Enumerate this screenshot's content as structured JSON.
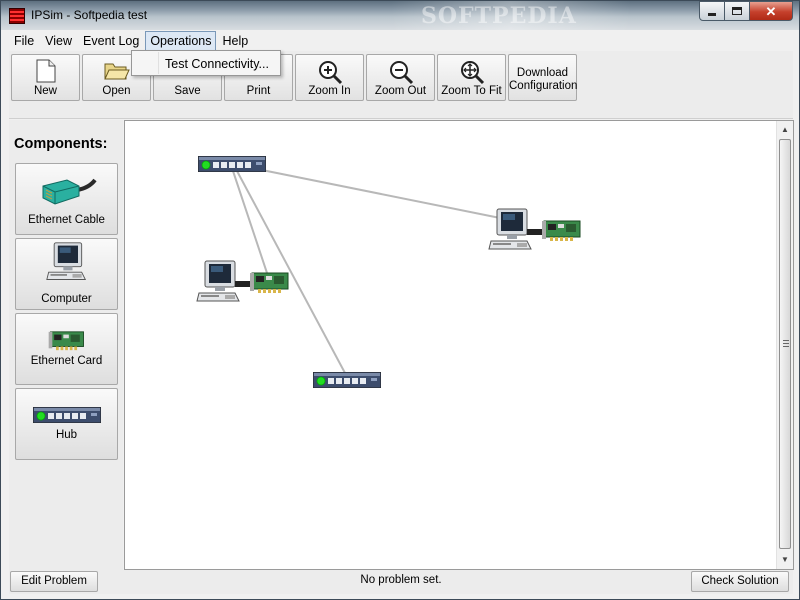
{
  "window": {
    "title": "IPSim - Softpedia test",
    "watermark": "SOFTPEDIA"
  },
  "menu": {
    "items": [
      {
        "label": "File"
      },
      {
        "label": "View"
      },
      {
        "label": "Event Log"
      },
      {
        "label": "Operations",
        "active": true
      },
      {
        "label": "Help"
      }
    ],
    "dropdown": {
      "items": [
        "Test Connectivity..."
      ]
    }
  },
  "toolbar": {
    "new": "New",
    "open": "Open",
    "save": "Save",
    "print": "Print",
    "zoom_in": "Zoom In",
    "zoom_out": "Zoom Out",
    "zoom_fit": "Zoom To Fit",
    "download_line1": "Download",
    "download_line2": "Configuration"
  },
  "sidebar": {
    "title": "Components:",
    "components": [
      {
        "label": "Ethernet Cable",
        "icon": "ethernet-cable-icon"
      },
      {
        "label": "Computer",
        "icon": "computer-icon"
      },
      {
        "label": "Ethernet Card",
        "icon": "ethernet-card-icon"
      },
      {
        "label": "Hub",
        "icon": "hub-icon"
      }
    ]
  },
  "canvas": {
    "nodes": [
      {
        "type": "hub",
        "id": "hub-1"
      },
      {
        "type": "hub",
        "id": "hub-2"
      },
      {
        "type": "computer",
        "id": "computer-1",
        "card": true
      },
      {
        "type": "computer",
        "id": "computer-2",
        "card": true
      }
    ],
    "links": [
      {
        "from": "hub-1",
        "to": "computer-2"
      },
      {
        "from": "hub-1",
        "to": "computer-1"
      },
      {
        "from": "hub-1",
        "to": "hub-2"
      }
    ]
  },
  "statusbar": {
    "edit_problem": "Edit Problem",
    "status": "No problem set.",
    "check_solution": "Check Solution"
  },
  "colors": {
    "hub_body": "#4a5a7a",
    "hub_led": "#22dd22",
    "card_pcb": "#3a8a4a",
    "cable": "#b8b8b8",
    "rj45": "#2aa89a"
  }
}
